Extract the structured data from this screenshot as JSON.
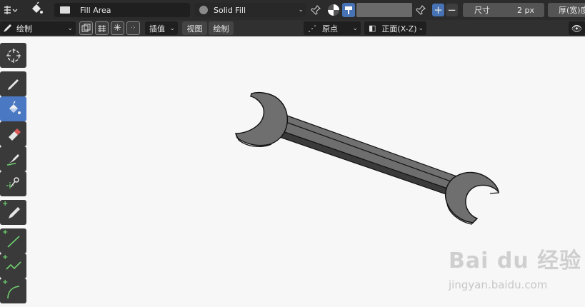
{
  "header": {
    "material_name": "Fill Area",
    "fill_style": "Solid Fill",
    "size_label": "尺寸",
    "size_value": "2 px",
    "thickness_label": "厚(宽)度"
  },
  "secondbar": {
    "mode": "绘制",
    "interpolate": "插值",
    "view": "视图",
    "draw": "绘制",
    "origin": "原点",
    "orientation": "正面(X-Z)"
  },
  "watermark": {
    "logo_text": "Bai du 经验",
    "url": "jingyan.baidu.com"
  },
  "colors": {
    "accent": "#4772b3",
    "topbar": "#2b2b2b",
    "viewport": "#f7f7f7",
    "wrench": "#6e6e6e"
  },
  "toolbar": {
    "tools": [
      "cursor-icon",
      "draw-icon",
      "fill-icon",
      "erase-icon",
      "tint-icon",
      "cutter-icon",
      "eyedropper-icon",
      "line-icon",
      "polyline-icon",
      "arc-icon"
    ],
    "active": "fill-icon"
  }
}
